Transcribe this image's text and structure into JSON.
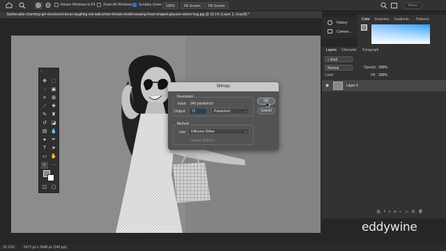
{
  "options_bar": {
    "resize_label": "Resize Windows to Fit",
    "zoom_all_label": "Zoom All Windows",
    "scrubby_label": "Scrubby Zoom",
    "zoom_value": "100%",
    "fit_screen_1": "Fill Screen",
    "fill_screen_2": "Fill Screen",
    "share_label": "Share"
  },
  "document": {
    "tab_title": "fashionable-charming-girl-checkered-dress-laughing-red-wall-photo-female-model-wearing-heart-shaped-glasses-wicker-bag.jpg @ 33.1% (Layer 3, Gray/8) *"
  },
  "dialog": {
    "title": "Bitmap",
    "resolution_label": "Resolution",
    "input_label": "Input:",
    "input_value": "240 pixels/inch",
    "output_label": "Output:",
    "output_value": "72",
    "output_unit": "Pixels/inch",
    "method_label": "Method",
    "use_label": "Use:",
    "use_value": "Diffusion Dither",
    "custom_pattern_label": "Custom Pattern:",
    "ok_label": "OK",
    "cancel_label": "Cancel"
  },
  "right_panel": {
    "history_label": "History",
    "comments_label": "Comme...",
    "color_tabs": [
      "Color",
      "Swatches",
      "Gradients",
      "Patterns"
    ],
    "layers_tabs": [
      "Layers",
      "Character",
      "Paragraph"
    ],
    "kind_label": "Kind",
    "blend_mode": "Normal",
    "opacity_label": "Opacity:",
    "opacity_value": "100%",
    "lock_label": "Lock:",
    "fill_label": "Fill:",
    "fill_value": "100%",
    "layer_name": "Layer 3"
  },
  "status_bar": {
    "zoom": "33.12%",
    "doc_info": "5472 px x 3648 px (240 ppi)"
  },
  "watermark": "eddywine",
  "colors": {
    "accent_blue": "#2d6fd6",
    "dialog_bg": "#535353",
    "panel_bg": "#323232"
  }
}
